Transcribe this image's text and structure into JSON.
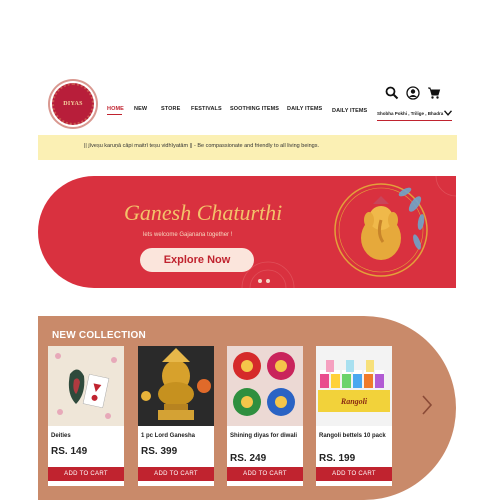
{
  "header": {
    "logo_text": "DIYAS",
    "nav": [
      "HOME",
      "NEW",
      "STORE",
      "FESTIVALS",
      "SOOTHING ITEMS",
      "DAILY ITEMS",
      "DAILY ITEMS"
    ],
    "active_nav": "HOME",
    "location": "Shobha Pokhi , Trilige , Bhadra",
    "icons": [
      "search-icon",
      "user-icon",
      "cart-icon"
    ]
  },
  "strip": {
    "text": "|| jīveṣu karuṇā cāpi maitrī teṣu vidhīyatām || - Be compassionate and friendly to all living beings."
  },
  "hero": {
    "title": "Ganesh Chaturthi",
    "subtitle": "lets welcome Gajanana together !",
    "button": "Explore Now",
    "dots": 2
  },
  "collection": {
    "title": "NEW COLLECTION",
    "products": [
      {
        "name": "Deities",
        "price": "RS. 149",
        "button": "ADD TO CART"
      },
      {
        "name": "1 pc Lord Ganesha",
        "price": "RS. 399",
        "button": "ADD TO CART"
      },
      {
        "name": "Shining diyas for diwali",
        "price": "RS. 249",
        "button": "ADD TO CART"
      },
      {
        "name": "Rangoli bettels 10 pack",
        "price": "RS. 199",
        "button": "ADD TO CART"
      }
    ],
    "rangoli_label": "Rangoli"
  },
  "colors": {
    "brand_red": "#c0232f",
    "hero_red": "#d9313f",
    "strip_yellow": "#fbf0b4",
    "collection_bg": "#c98a6a"
  }
}
